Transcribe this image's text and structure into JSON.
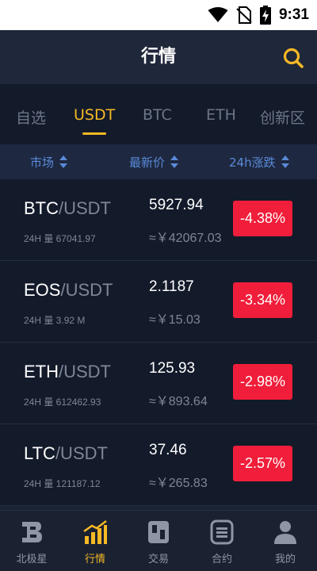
{
  "status_bar": {
    "time": "9:31"
  },
  "header": {
    "title": "行情",
    "search_icon": "search-icon",
    "accent_color": "#f5b925"
  },
  "tabs": [
    {
      "label": "自选",
      "active": false
    },
    {
      "label": "USDT",
      "active": true
    },
    {
      "label": "BTC",
      "active": false
    },
    {
      "label": "ETH",
      "active": false
    },
    {
      "label": "创新区",
      "active": false
    }
  ],
  "columns": {
    "market": "市场",
    "last_price": "最新价",
    "change_24h": "24h涨跌"
  },
  "rows": [
    {
      "base": "BTC",
      "quote": "/USDT",
      "volume": "24H 量 67041.97",
      "price": "5927.94",
      "cny": "≈￥42067.03",
      "change": "-4.38%"
    },
    {
      "base": "EOS",
      "quote": "/USDT",
      "volume": "24H 量 3.92 M",
      "price": "2.1187",
      "cny": "≈￥15.03",
      "change": "-3.34%"
    },
    {
      "base": "ETH",
      "quote": "/USDT",
      "volume": "24H 量 612462.93",
      "price": "125.93",
      "cny": "≈￥893.64",
      "change": "-2.98%"
    },
    {
      "base": "LTC",
      "quote": "/USDT",
      "volume": "24H 量 121187.12",
      "price": "37.46",
      "cny": "≈￥265.83",
      "change": "-2.57%"
    }
  ],
  "colors": {
    "down": "#f01e3a",
    "accent": "#f5b925",
    "column_header": "#5a8ad8"
  },
  "bottom_nav": [
    {
      "label": "北极星",
      "icon": "polaris-icon",
      "active": false
    },
    {
      "label": "行情",
      "icon": "market-chart-icon",
      "active": true
    },
    {
      "label": "交易",
      "icon": "trade-icon",
      "active": false
    },
    {
      "label": "合约",
      "icon": "contract-icon",
      "active": false
    },
    {
      "label": "我的",
      "icon": "profile-icon",
      "active": false
    }
  ]
}
